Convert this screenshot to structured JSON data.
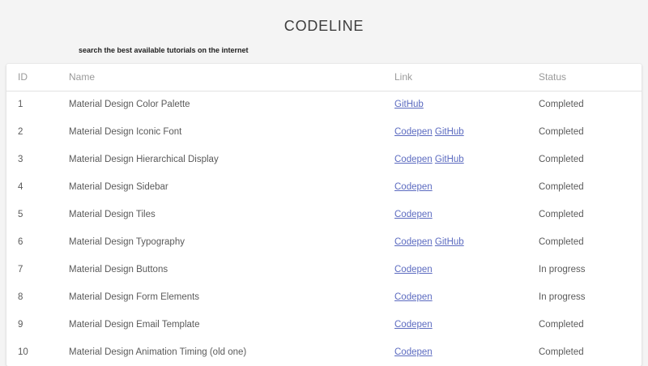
{
  "page": {
    "title": "CODELINE",
    "subtitle": "search the best available tutorials on the internet"
  },
  "table": {
    "columns": [
      "ID",
      "Name",
      "Link",
      "Status"
    ],
    "rows": [
      {
        "id": "1",
        "name": "Material Design Color Palette",
        "links": [
          "GitHub"
        ],
        "status": "Completed"
      },
      {
        "id": "2",
        "name": "Material Design Iconic Font",
        "links": [
          "Codepen",
          "GitHub"
        ],
        "status": "Completed"
      },
      {
        "id": "3",
        "name": "Material Design Hierarchical Display",
        "links": [
          "Codepen",
          "GitHub"
        ],
        "status": "Completed"
      },
      {
        "id": "4",
        "name": "Material Design Sidebar",
        "links": [
          "Codepen"
        ],
        "status": "Completed"
      },
      {
        "id": "5",
        "name": "Material Design Tiles",
        "links": [
          "Codepen"
        ],
        "status": "Completed"
      },
      {
        "id": "6",
        "name": "Material Design Typography",
        "links": [
          "Codepen",
          "GitHub"
        ],
        "status": "Completed"
      },
      {
        "id": "7",
        "name": "Material Design Buttons",
        "links": [
          "Codepen"
        ],
        "status": "In progress"
      },
      {
        "id": "8",
        "name": "Material Design Form Elements",
        "links": [
          "Codepen"
        ],
        "status": "In progress"
      },
      {
        "id": "9",
        "name": "Material Design Email Template",
        "links": [
          "Codepen"
        ],
        "status": "Completed"
      },
      {
        "id": "10",
        "name": "Material Design Animation Timing (old one)",
        "links": [
          "Codepen"
        ],
        "status": "Completed"
      }
    ]
  },
  "colors": {
    "link": "#5c6bc0",
    "page_background": "#f4f4f4",
    "card_background": "#ffffff",
    "header_text": "#9a9a9a",
    "cell_text": "#5a5a5a",
    "title_text": "#3d3d3d"
  }
}
